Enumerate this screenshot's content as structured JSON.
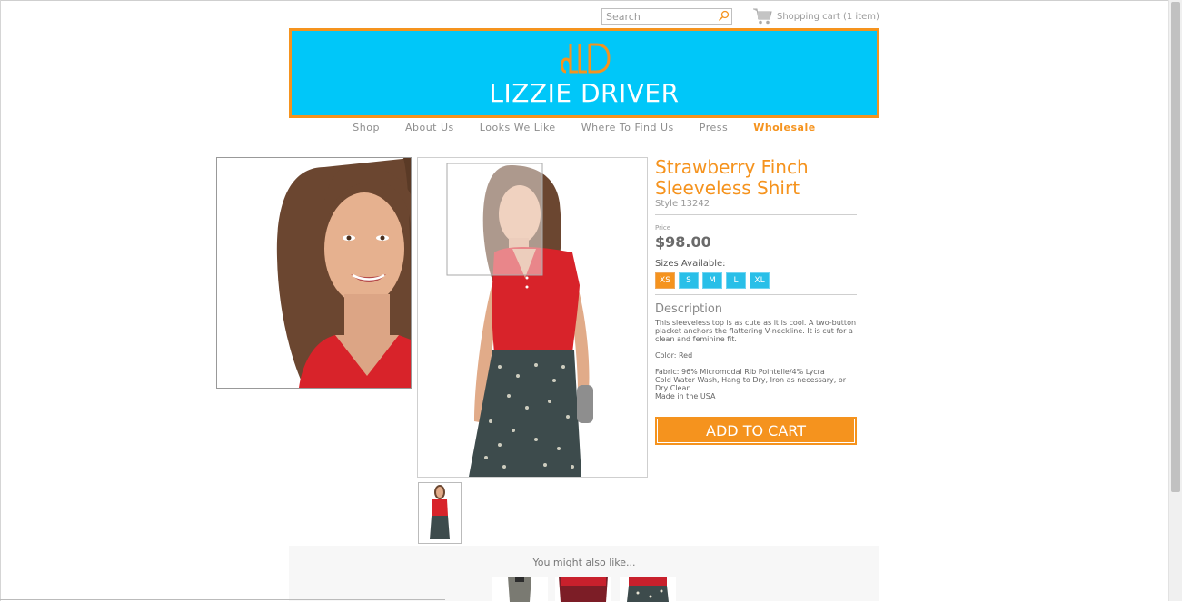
{
  "header": {
    "search_placeholder": "Search",
    "cart_label": "Shopping cart (1 item)"
  },
  "brand": {
    "name": "LIZZIE DRIVER",
    "banner_color": "#00c7f9",
    "accent_color": "#f5931e"
  },
  "nav": {
    "items": [
      {
        "label": "Shop"
      },
      {
        "label": "About Us"
      },
      {
        "label": "Looks We Like"
      },
      {
        "label": "Where To Find Us"
      },
      {
        "label": "Press"
      },
      {
        "label": "Wholesale"
      }
    ]
  },
  "product": {
    "title": "Strawberry Finch Sleeveless Shirt",
    "style": "Style 13242",
    "price_label": "Price",
    "price": "$98.00",
    "sizes_label": "Sizes Available:",
    "sizes": [
      "XS",
      "S",
      "M",
      "L",
      "XL"
    ],
    "selected_size": "XS",
    "description_title": "Description",
    "description": "This sleeveless top is as cute as it is cool. A two-button placket anchors the flattering V-neckline. It is cut for a clean and feminine fit.",
    "color": "Color: Red",
    "fabric_1": "Fabric: 96% Micromodal Rib Pointelle/4% Lycra",
    "fabric_2": "Cold Water Wash, Hang to Dry, Iron as necessary, or Dry Clean",
    "fabric_3": "Made in the USA",
    "add_to_cart": "ADD TO CART"
  },
  "related": {
    "title": "You might also like..."
  }
}
